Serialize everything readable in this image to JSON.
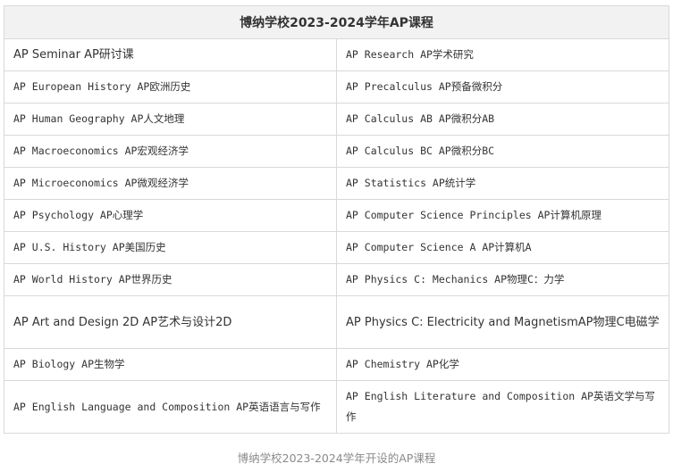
{
  "table": {
    "title": "博纳学校2023-2024学年AP课程",
    "rows": [
      {
        "left": "AP Seminar AP研讨课",
        "right": "AP Research AP学术研究"
      },
      {
        "left": "AP European History  AP欧洲历史",
        "right": "AP Precalculus AP预备微积分"
      },
      {
        "left": "AP Human Geography  AP人文地理",
        "right": "AP Calculus AB AP微积分AB"
      },
      {
        "left": "AP Macroeconomics  AP宏观经济学",
        "right": "AP Calculus BC AP微积分BC"
      },
      {
        "left": "AP Microeconomics AP微观经济学",
        "right": "AP Statistics AP统计学"
      },
      {
        "left": "AP Psychology   AP心理学",
        "right": "AP Computer Science Principles AP计算机原理"
      },
      {
        "left": "AP U.S. History AP美国历史",
        "right": "AP Computer Science A AP计算机A"
      },
      {
        "left": "AP World History    AP世界历史",
        "right": "AP Physics C: Mechanics AP物理C：力学"
      },
      {
        "left": "AP Art and Design 2D AP艺术与设计2D",
        "right": "AP Physics C: Electricity and MagnetismAP物理C电磁学"
      },
      {
        "left": "AP Biology AP生物学",
        "right": "AP Chemistry AP化学"
      },
      {
        "left": "AP English Language and Composition AP英语语言与写作",
        "right": "AP English Literature and Composition AP英语文学与写作"
      }
    ]
  },
  "caption": "博纳学校2023-2024学年开设的AP课程"
}
